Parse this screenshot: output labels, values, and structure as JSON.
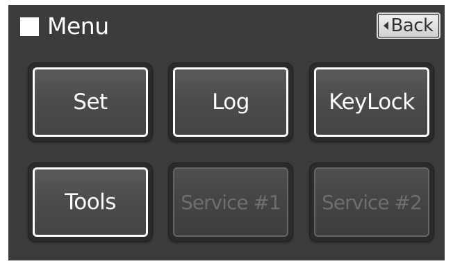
{
  "header": {
    "title": "Menu",
    "back_label": "Back"
  },
  "tiles": [
    {
      "label": "Set",
      "enabled": true
    },
    {
      "label": "Log",
      "enabled": true
    },
    {
      "label": "KeyLock",
      "enabled": true
    },
    {
      "label": "Tools",
      "enabled": true
    },
    {
      "label": "Service #1",
      "enabled": false
    },
    {
      "label": "Service #2",
      "enabled": false
    }
  ],
  "colors": {
    "background": "#3c3c3c",
    "tile_border_enabled": "#ffffff",
    "tile_border_disabled": "#666666",
    "text_enabled": "#ffffff",
    "text_disabled": "#6e6e6e"
  }
}
